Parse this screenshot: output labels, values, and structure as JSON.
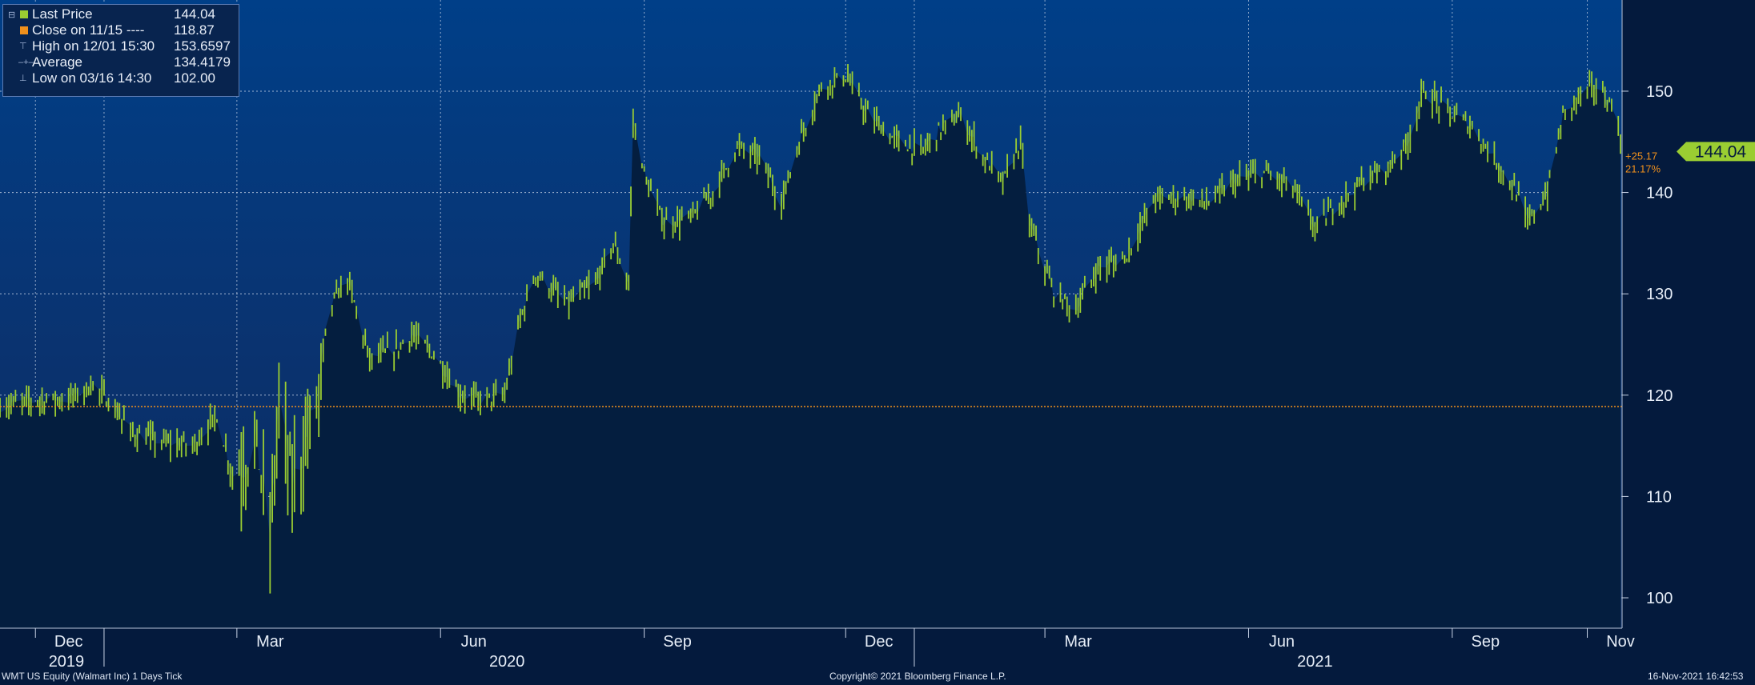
{
  "legend": {
    "rows": [
      {
        "label": "Last Price",
        "value": "144.04",
        "color": "#9acd32"
      },
      {
        "label": "Close on 11/15 ----",
        "value": "118.87",
        "color": "#f0901c"
      },
      {
        "label": "High on 12/01 15:30",
        "value": "153.6597",
        "color": ""
      },
      {
        "label": "Average",
        "value": "134.4179",
        "color": ""
      },
      {
        "label": "Low on 03/16 14:30",
        "value": "102.00",
        "color": ""
      }
    ]
  },
  "last_badge": "144.04",
  "change": {
    "abs": "+25.17",
    "pct": "21.17%"
  },
  "footer": {
    "left": "WMT US Equity (Walmart Inc) 1 Days  Tick",
    "center": "Copyright© 2021 Bloomberg Finance L.P.",
    "right": "16-Nov-2021 16:42:53"
  },
  "colors": {
    "price": "#9acd32",
    "reference": "#f0901c",
    "background": "#041a3d",
    "area": "#041e3f",
    "badge": "#9acd32"
  },
  "chart_data": {
    "type": "bar",
    "subtype": "ohlc-range-bars",
    "y_ticks": [
      100,
      110,
      120,
      130,
      140,
      150
    ],
    "ylim": [
      97,
      159
    ],
    "x_month_labels": [
      "Dec",
      "Mar",
      "Jun",
      "Sep",
      "Dec",
      "Mar",
      "Jun",
      "Sep",
      "Nov"
    ],
    "x_year_labels": [
      "2019",
      "2020",
      "2021"
    ],
    "grid": true,
    "reference_line": 118.87,
    "last_price": 144.04,
    "high": 153.6597,
    "low": 102.0,
    "average": 134.4179,
    "points": [
      {
        "date": "2019-11-15",
        "value": 118.9
      },
      {
        "date": "2019-12-02",
        "value": 119.5
      },
      {
        "date": "2019-12-16",
        "value": 119.6
      },
      {
        "date": "2019-12-27",
        "value": 121.0
      },
      {
        "date": "2020-01-03",
        "value": 119.4
      },
      {
        "date": "2020-01-14",
        "value": 116.2
      },
      {
        "date": "2020-01-28",
        "value": 115.3
      },
      {
        "date": "2020-02-10",
        "value": 115.0
      },
      {
        "date": "2020-02-21",
        "value": 118.0
      },
      {
        "date": "2020-02-28",
        "value": 112.0
      },
      {
        "date": "2020-03-10",
        "value": 115.0
      },
      {
        "date": "2020-03-16",
        "value": 106.0
      },
      {
        "date": "2020-03-20",
        "value": 119.0
      },
      {
        "date": "2020-03-26",
        "value": 111.0
      },
      {
        "date": "2020-04-06",
        "value": 119.0
      },
      {
        "date": "2020-04-13",
        "value": 129.0
      },
      {
        "date": "2020-04-20",
        "value": 131.5
      },
      {
        "date": "2020-04-30",
        "value": 123.5
      },
      {
        "date": "2020-05-12",
        "value": 124.5
      },
      {
        "date": "2020-05-19",
        "value": 126.0
      },
      {
        "date": "2020-05-29",
        "value": 124.0
      },
      {
        "date": "2020-06-10",
        "value": 120.0
      },
      {
        "date": "2020-06-19",
        "value": 119.5
      },
      {
        "date": "2020-06-30",
        "value": 120.0
      },
      {
        "date": "2020-07-07",
        "value": 127.5
      },
      {
        "date": "2020-07-14",
        "value": 132.0
      },
      {
        "date": "2020-07-28",
        "value": 129.0
      },
      {
        "date": "2020-08-10",
        "value": 131.0
      },
      {
        "date": "2020-08-18",
        "value": 135.0
      },
      {
        "date": "2020-08-25",
        "value": 131.0
      },
      {
        "date": "2020-08-27",
        "value": 147.0
      },
      {
        "date": "2020-09-02",
        "value": 141.0
      },
      {
        "date": "2020-09-10",
        "value": 137.0
      },
      {
        "date": "2020-09-22",
        "value": 137.5
      },
      {
        "date": "2020-10-02",
        "value": 140.0
      },
      {
        "date": "2020-10-13",
        "value": 144.5
      },
      {
        "date": "2020-10-23",
        "value": 143.5
      },
      {
        "date": "2020-11-02",
        "value": 139.0
      },
      {
        "date": "2020-11-10",
        "value": 145.0
      },
      {
        "date": "2020-11-20",
        "value": 150.5
      },
      {
        "date": "2020-12-01",
        "value": 151.5
      },
      {
        "date": "2020-12-10",
        "value": 148.0
      },
      {
        "date": "2020-12-21",
        "value": 145.5
      },
      {
        "date": "2021-01-04",
        "value": 144.0
      },
      {
        "date": "2021-01-14",
        "value": 146.5
      },
      {
        "date": "2021-01-22",
        "value": 147.5
      },
      {
        "date": "2021-02-01",
        "value": 143.5
      },
      {
        "date": "2021-02-10",
        "value": 141.0
      },
      {
        "date": "2021-02-18",
        "value": 145.0
      },
      {
        "date": "2021-02-22",
        "value": 137.0
      },
      {
        "date": "2021-03-05",
        "value": 130.0
      },
      {
        "date": "2021-03-15",
        "value": 128.5
      },
      {
        "date": "2021-03-25",
        "value": 132.5
      },
      {
        "date": "2021-04-06",
        "value": 133.5
      },
      {
        "date": "2021-04-20",
        "value": 139.5
      },
      {
        "date": "2021-05-03",
        "value": 139.5
      },
      {
        "date": "2021-05-14",
        "value": 139.0
      },
      {
        "date": "2021-05-25",
        "value": 141.0
      },
      {
        "date": "2021-06-08",
        "value": 142.0
      },
      {
        "date": "2021-06-21",
        "value": 140.5
      },
      {
        "date": "2021-07-01",
        "value": 136.5
      },
      {
        "date": "2021-07-12",
        "value": 139.0
      },
      {
        "date": "2021-07-22",
        "value": 141.0
      },
      {
        "date": "2021-08-03",
        "value": 142.5
      },
      {
        "date": "2021-08-12",
        "value": 145.0
      },
      {
        "date": "2021-08-19",
        "value": 150.0
      },
      {
        "date": "2021-08-30",
        "value": 148.0
      },
      {
        "date": "2021-09-10",
        "value": 146.5
      },
      {
        "date": "2021-09-21",
        "value": 143.0
      },
      {
        "date": "2021-09-30",
        "value": 140.0
      },
      {
        "date": "2021-10-05",
        "value": 137.0
      },
      {
        "date": "2021-10-14",
        "value": 140.0
      },
      {
        "date": "2021-10-21",
        "value": 147.5
      },
      {
        "date": "2021-10-28",
        "value": 149.5
      },
      {
        "date": "2021-11-05",
        "value": 150.5
      },
      {
        "date": "2021-11-10",
        "value": 149.0
      },
      {
        "date": "2021-11-15",
        "value": 147.5
      },
      {
        "date": "2021-11-16",
        "value": 144.04
      }
    ]
  }
}
